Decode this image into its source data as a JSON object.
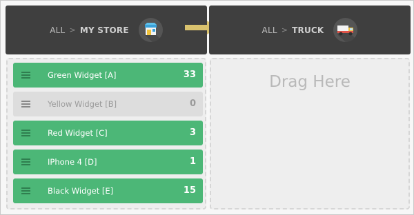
{
  "source": {
    "all_label": "ALL",
    "separator": ">",
    "name": "MY STORE",
    "icon": "store-icon"
  },
  "target": {
    "all_label": "ALL",
    "separator": ">",
    "name": "TRUCK",
    "icon": "truck-icon"
  },
  "transfer_arrow": "right-arrow-icon",
  "items": [
    {
      "label": "Green Widget [A]",
      "count": "33",
      "state": "active"
    },
    {
      "label": "Yellow Widget [B]",
      "count": "0",
      "state": "disabled"
    },
    {
      "label": "Red Widget [C]",
      "count": "3",
      "state": "active"
    },
    {
      "label": "IPhone 4 [D]",
      "count": "1",
      "state": "active"
    },
    {
      "label": "Black Widget [E]",
      "count": "15",
      "state": "active"
    }
  ],
  "drop_zone": {
    "text": "Drag Here"
  },
  "colors": {
    "header_bg": "#3f3f3f",
    "item_green": "#4cb777",
    "item_disabled": "#dddddd",
    "arrow": "#d9c26e"
  }
}
